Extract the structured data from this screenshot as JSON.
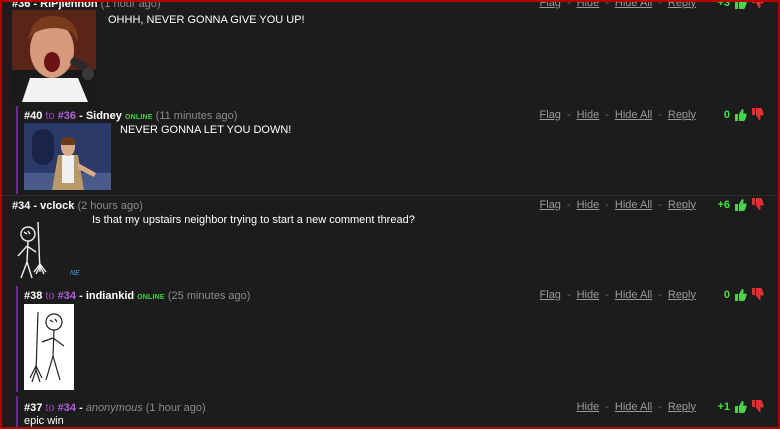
{
  "actions": {
    "flag": "Flag",
    "hide": "Hide",
    "hide_all": "Hide All",
    "reply": "Reply",
    "sep": "-"
  },
  "colors": {
    "frame": "#b80000",
    "reply_link": "#b060e0",
    "online": "#3fd43f",
    "score": "#44e044",
    "thumb_up": "#4cd24c",
    "thumb_down": "#e03030"
  },
  "comments": [
    {
      "num": "#36",
      "user": "RIPjlennon",
      "time": "(1 hour ago)",
      "text": "OHHH, NEVER GONNA GIVE YOU UP!",
      "score": "+3"
    },
    {
      "num": "#40",
      "to_word": "to",
      "to_num": "#36",
      "user": "Sidney",
      "online": "ONLINE",
      "time": "(11 minutes ago)",
      "text": "NEVER GONNA LET YOU DOWN!",
      "score": "0"
    },
    {
      "num": "#34",
      "user": "vclock",
      "time": "(2 hours ago)",
      "text": "Is that my upstairs neighbor trying to start a new comment thread?",
      "score": "+6",
      "avatar_sig": "NE"
    },
    {
      "num": "#38",
      "to_word": "to",
      "to_num": "#34",
      "user": "indiankid",
      "online": "ONLINE",
      "time": "(25 minutes ago)",
      "text": "",
      "score": "0"
    },
    {
      "num": "#37",
      "to_word": "to",
      "to_num": "#34",
      "user": "anonymous",
      "time": "(1 hour ago)",
      "text": "epic win",
      "score": "+1"
    }
  ],
  "separators": {
    "dash": " - "
  }
}
